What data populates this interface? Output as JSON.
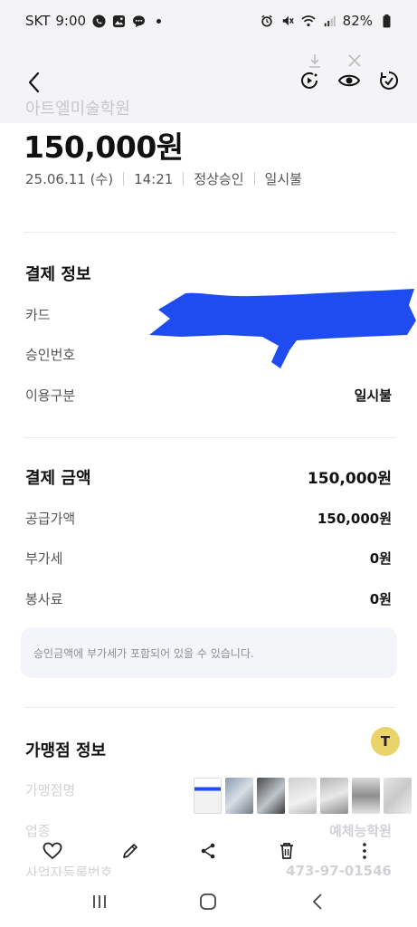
{
  "status": {
    "carrier": "SKT",
    "time": "9:00",
    "battery": "82%"
  },
  "header": {
    "merchant_title": "아트엘미술학원"
  },
  "summary": {
    "amount": "150,000원",
    "date": "25.06.11 (수)",
    "time": "14:21",
    "status": "정상승인",
    "installment": "일시불"
  },
  "payment_info": {
    "title": "결제 정보",
    "rows": [
      {
        "label": "카드",
        "value": ""
      },
      {
        "label": "승인번호",
        "value": ""
      },
      {
        "label": "이용구분",
        "value": "일시불"
      }
    ]
  },
  "payment_amount": {
    "title": "결제 금액",
    "total": "150,000원",
    "rows": [
      {
        "label": "공급가액",
        "value": "150,000원"
      },
      {
        "label": "부가세",
        "value": "0원"
      },
      {
        "label": "봉사료",
        "value": "0원"
      }
    ],
    "notice": "승인금액에 부가세가 포함되어 있을 수 있습니다."
  },
  "merchant_info": {
    "title": "가맹점 정보",
    "rows": [
      {
        "label": "가맹점명",
        "value": ""
      },
      {
        "label": "업종",
        "value": "예체능학원"
      },
      {
        "label": "사업자등록번호",
        "value": "473-97-01546"
      }
    ]
  },
  "ocr_button": {
    "label": "T"
  },
  "colors": {
    "redaction": "#1f4cf0",
    "ocr_badge": "#e9d36a",
    "notice_bg": "#f4f5f8"
  },
  "icons": {
    "header": [
      "back-arrow-icon",
      "motion-photo-icon",
      "eye-icon",
      "remaster-icon"
    ],
    "actions": [
      "heart-icon",
      "pencil-icon",
      "share-icon",
      "trash-icon",
      "more-icon"
    ],
    "nav": [
      "recents-icon",
      "home-icon",
      "back-icon"
    ]
  }
}
